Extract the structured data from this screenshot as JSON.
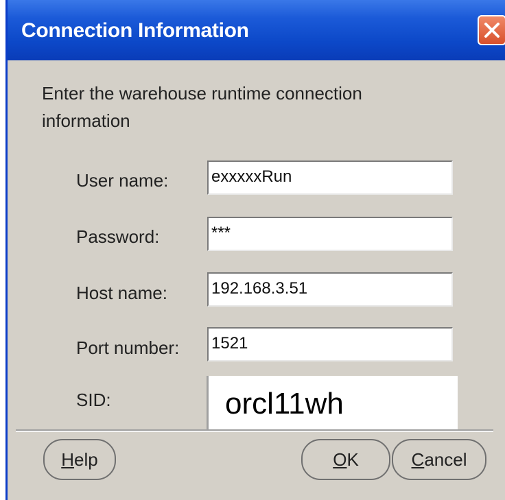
{
  "window": {
    "title": "Connection Information"
  },
  "instructions": "Enter the warehouse runtime connection information",
  "fields": {
    "user_name": {
      "label": "User name:",
      "value": "exxxxxRun"
    },
    "password": {
      "label": "Password:",
      "value": "***"
    },
    "host_name": {
      "label": "Host name:",
      "value": "192.168.3.51"
    },
    "port_number": {
      "label": "Port number:",
      "value": "1521"
    },
    "sid": {
      "label": "SID:",
      "value": "orcl11wh"
    }
  },
  "buttons": {
    "help": {
      "mnemonic": "H",
      "rest": "elp"
    },
    "ok": {
      "mnemonic": "O",
      "rest": "K"
    },
    "cancel": {
      "mnemonic": "C",
      "rest": "ancel"
    }
  },
  "colors": {
    "title_bar": "#0c48c8",
    "close_button": "#e0623a",
    "dialog_bg": "#d4d0c8"
  },
  "icons": {
    "close": "close-icon"
  }
}
